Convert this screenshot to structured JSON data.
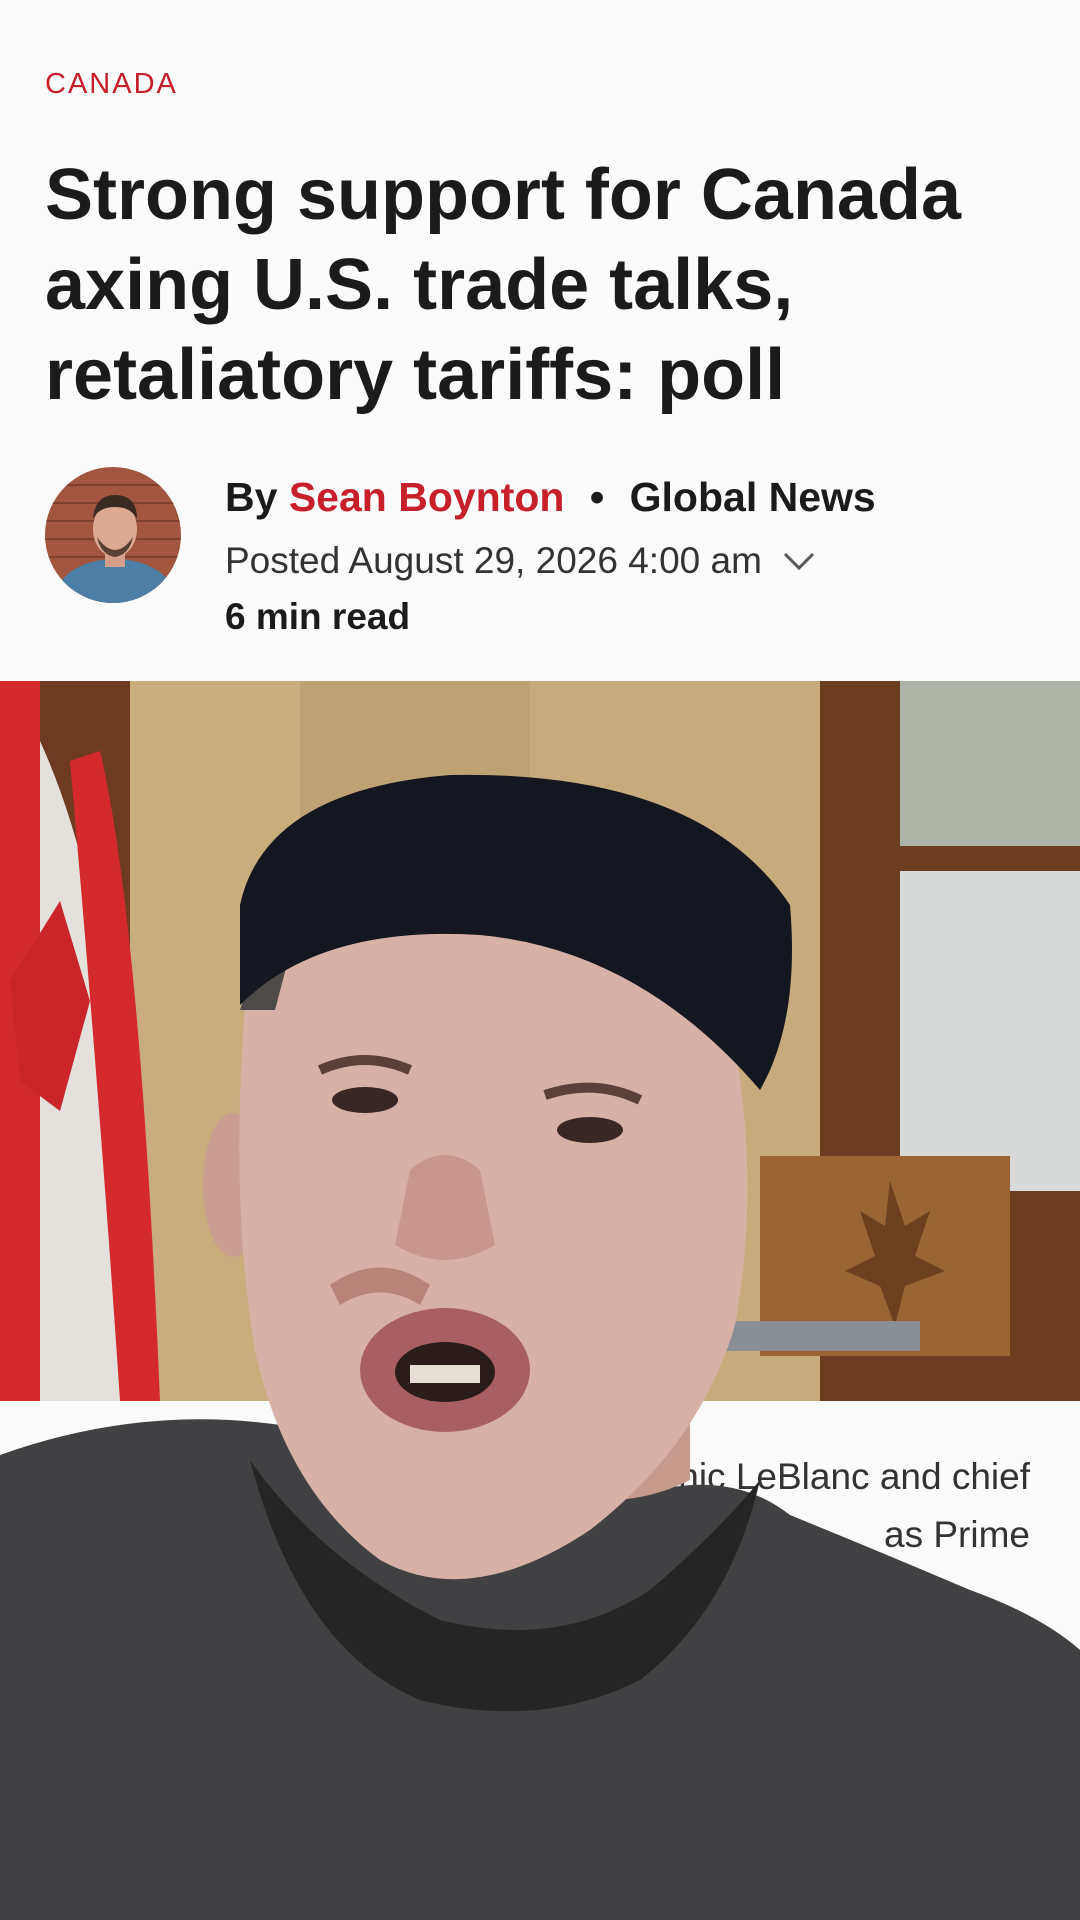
{
  "article": {
    "section": "CANADA",
    "headline": "Strong support for Canada axing U.S. trade talks, retaliatory tariffs: poll",
    "byline_prefix": "By",
    "author": "Sean Boynton",
    "separator": "•",
    "publisher": "Global News",
    "posted": "Posted August 29, 2026 4:00 am",
    "read_time": "6 min read",
    "caption_partial_line1": "inic LeBlanc and chief",
    "caption_partial_line2": "as Prime"
  },
  "icons": {
    "expand": "chevron-down-icon"
  },
  "colors": {
    "accent": "#c8202a",
    "text": "#1b1b1b",
    "background": "#fbfbfc"
  }
}
